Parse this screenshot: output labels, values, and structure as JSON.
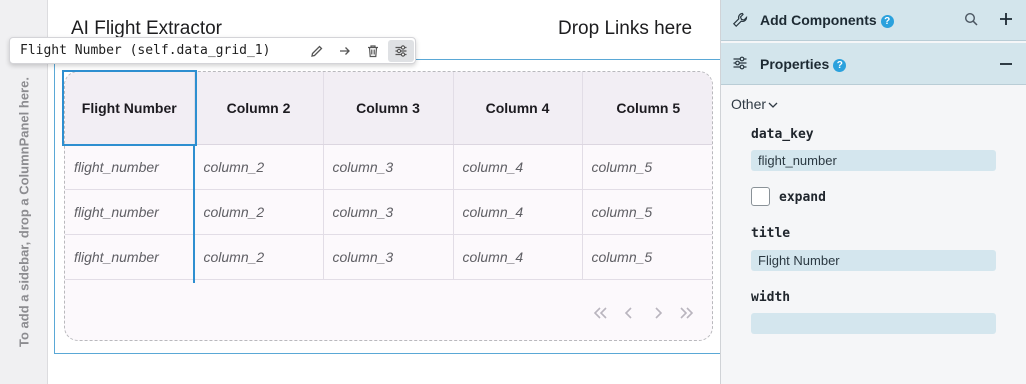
{
  "app": {
    "title": "AI Flight Extractor",
    "drop_links": "Drop Links here",
    "sidebar_hint": "To add a sidebar, drop a ColumnPanel here."
  },
  "component_toolbar": {
    "label": "Flight Number (self.data_grid_1)",
    "buttons": [
      "edit-icon",
      "arrow-right-icon",
      "trash-icon",
      "sliders-icon"
    ]
  },
  "grid": {
    "columns": [
      "Flight Number",
      "Column 2",
      "Column 3",
      "Column 4",
      "Column 5"
    ],
    "rows": [
      [
        "flight_number",
        "column_2",
        "column_3",
        "column_4",
        "column_5"
      ],
      [
        "flight_number",
        "column_2",
        "column_3",
        "column_4",
        "column_5"
      ],
      [
        "flight_number",
        "column_2",
        "column_3",
        "column_4",
        "column_5"
      ]
    ],
    "pager_icons": [
      "first-page-icon",
      "prev-page-icon",
      "next-page-icon",
      "last-page-icon"
    ]
  },
  "right_panel": {
    "add_components": {
      "title": "Add Components",
      "help": "?"
    },
    "properties": {
      "title": "Properties",
      "help": "?",
      "section": "Other",
      "data_key_label": "data_key",
      "data_key_value": "flight_number",
      "expand_label": "expand",
      "expand_checked": false,
      "title_label": "title",
      "title_value": "Flight Number",
      "width_label": "width",
      "width_value": ""
    }
  },
  "colors": {
    "accent": "#2e8fd0",
    "panel_header": "#d3e5ec",
    "input_bg": "#d4e6ee",
    "help": "#2aa1dd"
  }
}
